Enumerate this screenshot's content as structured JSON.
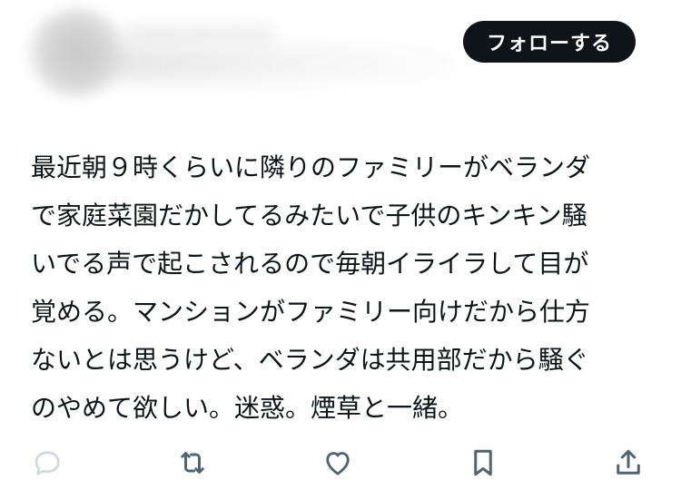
{
  "header": {
    "follow_label": "フォローする"
  },
  "tweet": {
    "lines": [
      "最近朝９時くらいに隣りのファミリーがベランダ",
      "で家庭菜園だかしてるみたいで子供のキンキン騒",
      "いでる声で起こされるので毎朝イライラして目が",
      "覚める。マンションがファミリー向けだから仕方",
      "ないとは思うけど、ベランダは共用部だから騒ぐ",
      "のやめて欲しい。迷惑。煙草と一緒。"
    ]
  },
  "actions": [
    {
      "icon": "reply-icon",
      "color": "#cfd9de"
    },
    {
      "icon": "retweet-icon",
      "color": "#536471"
    },
    {
      "icon": "like-icon",
      "color": "#536471"
    },
    {
      "icon": "bookmark-icon",
      "color": "#536471"
    },
    {
      "icon": "share-icon",
      "color": "#536471"
    }
  ]
}
